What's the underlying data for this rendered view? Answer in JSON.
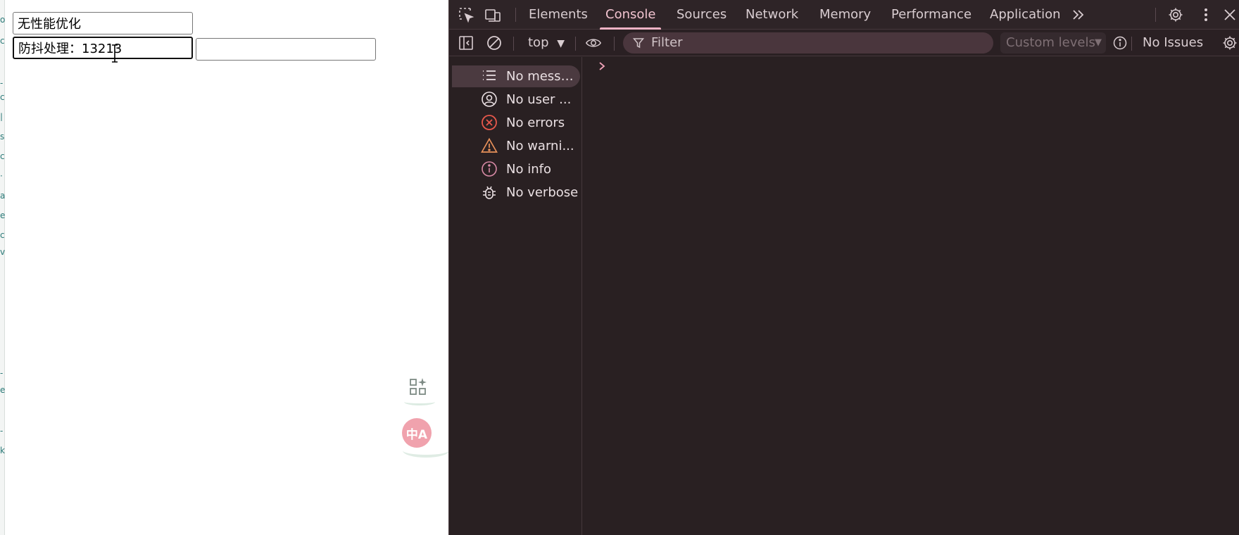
{
  "page": {
    "input_plain_value": "无性能优化",
    "input_debounce_value": "防抖处理：13213",
    "input_empty_value": "",
    "left_edge_chars": [
      "o",
      "c",
      "-",
      "c",
      "|",
      "s",
      "c",
      "·",
      "a",
      "e",
      "c",
      "v",
      "-",
      "e",
      "-",
      "k"
    ]
  },
  "floating": {
    "apps_icon": "apps-sparkle-icon",
    "translate_label": "中A"
  },
  "devtools": {
    "tabs": [
      "Elements",
      "Console",
      "Sources",
      "Network",
      "Memory",
      "Performance",
      "Application"
    ],
    "active_tab": "Console",
    "toolbar": {
      "context": "top",
      "filter_placeholder": "Filter",
      "levels": "Custom levels",
      "issues": "No Issues"
    },
    "sidebar": [
      {
        "label": "No messa...",
        "icon": "list-icon",
        "selected": true
      },
      {
        "label": "No user ...",
        "icon": "user-icon",
        "selected": false
      },
      {
        "label": "No errors",
        "icon": "error-icon",
        "selected": false
      },
      {
        "label": "No warni...",
        "icon": "warning-icon",
        "selected": false
      },
      {
        "label": "No info",
        "icon": "info-icon",
        "selected": false
      },
      {
        "label": "No verbose",
        "icon": "bug-icon",
        "selected": false
      }
    ],
    "colors": {
      "background": "#292022",
      "accent": "#f0b2c4",
      "error": "#e8584c",
      "warning": "#e8915a",
      "info": "#d98aa6"
    }
  }
}
